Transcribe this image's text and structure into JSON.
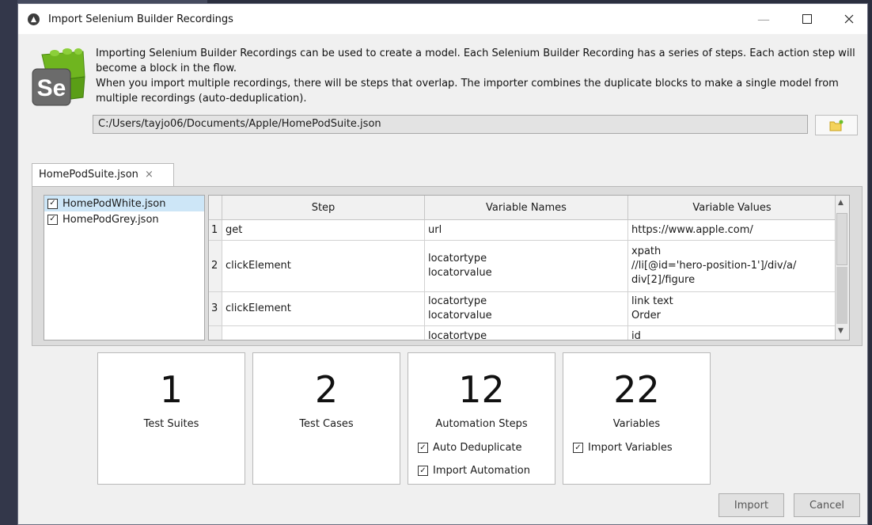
{
  "window": {
    "title": "Import Selenium Builder Recordings"
  },
  "intro": {
    "paragraph1": "Importing Selenium Builder Recordings can be used to create a model. Each Selenium Builder Recording has a series of steps. Each action step will become a block in the flow.",
    "paragraph2": "When you import multiple recordings, there will be steps that overlap. The importer combines the duplicate blocks to make a single model from multiple recordings (auto-deduplication).",
    "logo_text": "Se"
  },
  "path": {
    "value": "C:/Users/tayjo06/Documents/Apple/HomePodSuite.json"
  },
  "tab": {
    "label": "HomePodSuite.json",
    "close": "×"
  },
  "files": [
    {
      "name": "HomePodWhite.json",
      "checked": "☑"
    },
    {
      "name": "HomePodGrey.json",
      "checked": "☑"
    }
  ],
  "grid": {
    "headers": {
      "step": "Step",
      "names": "Variable Names",
      "values": "Variable Values"
    },
    "rows": [
      {
        "num": "1",
        "step": "get",
        "names": [
          "url"
        ],
        "values": [
          "https://www.apple.com/"
        ]
      },
      {
        "num": "2",
        "step": "clickElement",
        "names": [
          "locatortype",
          "locatorvalue"
        ],
        "values": [
          "xpath",
          "//li[@id='hero-position-1']/div/a/",
          "div[2]/figure"
        ]
      },
      {
        "num": "3",
        "step": "clickElement",
        "names": [
          "locatortype",
          "locatorvalue"
        ],
        "values": [
          "link text",
          "Order"
        ]
      },
      {
        "num": "",
        "step": "",
        "names": [
          "locatortype"
        ],
        "values": [
          "id"
        ]
      }
    ]
  },
  "stats": {
    "suites": {
      "value": "1",
      "label": "Test Suites"
    },
    "cases": {
      "value": "2",
      "label": "Test Cases"
    },
    "steps": {
      "value": "12",
      "label": "Automation Steps"
    },
    "variables": {
      "value": "22",
      "label": "Variables"
    }
  },
  "options": {
    "auto_dedup": "Auto Deduplicate",
    "import_automation": "Import Automation",
    "import_variables": "Import Variables"
  },
  "buttons": {
    "import": "Import",
    "cancel": "Cancel"
  }
}
